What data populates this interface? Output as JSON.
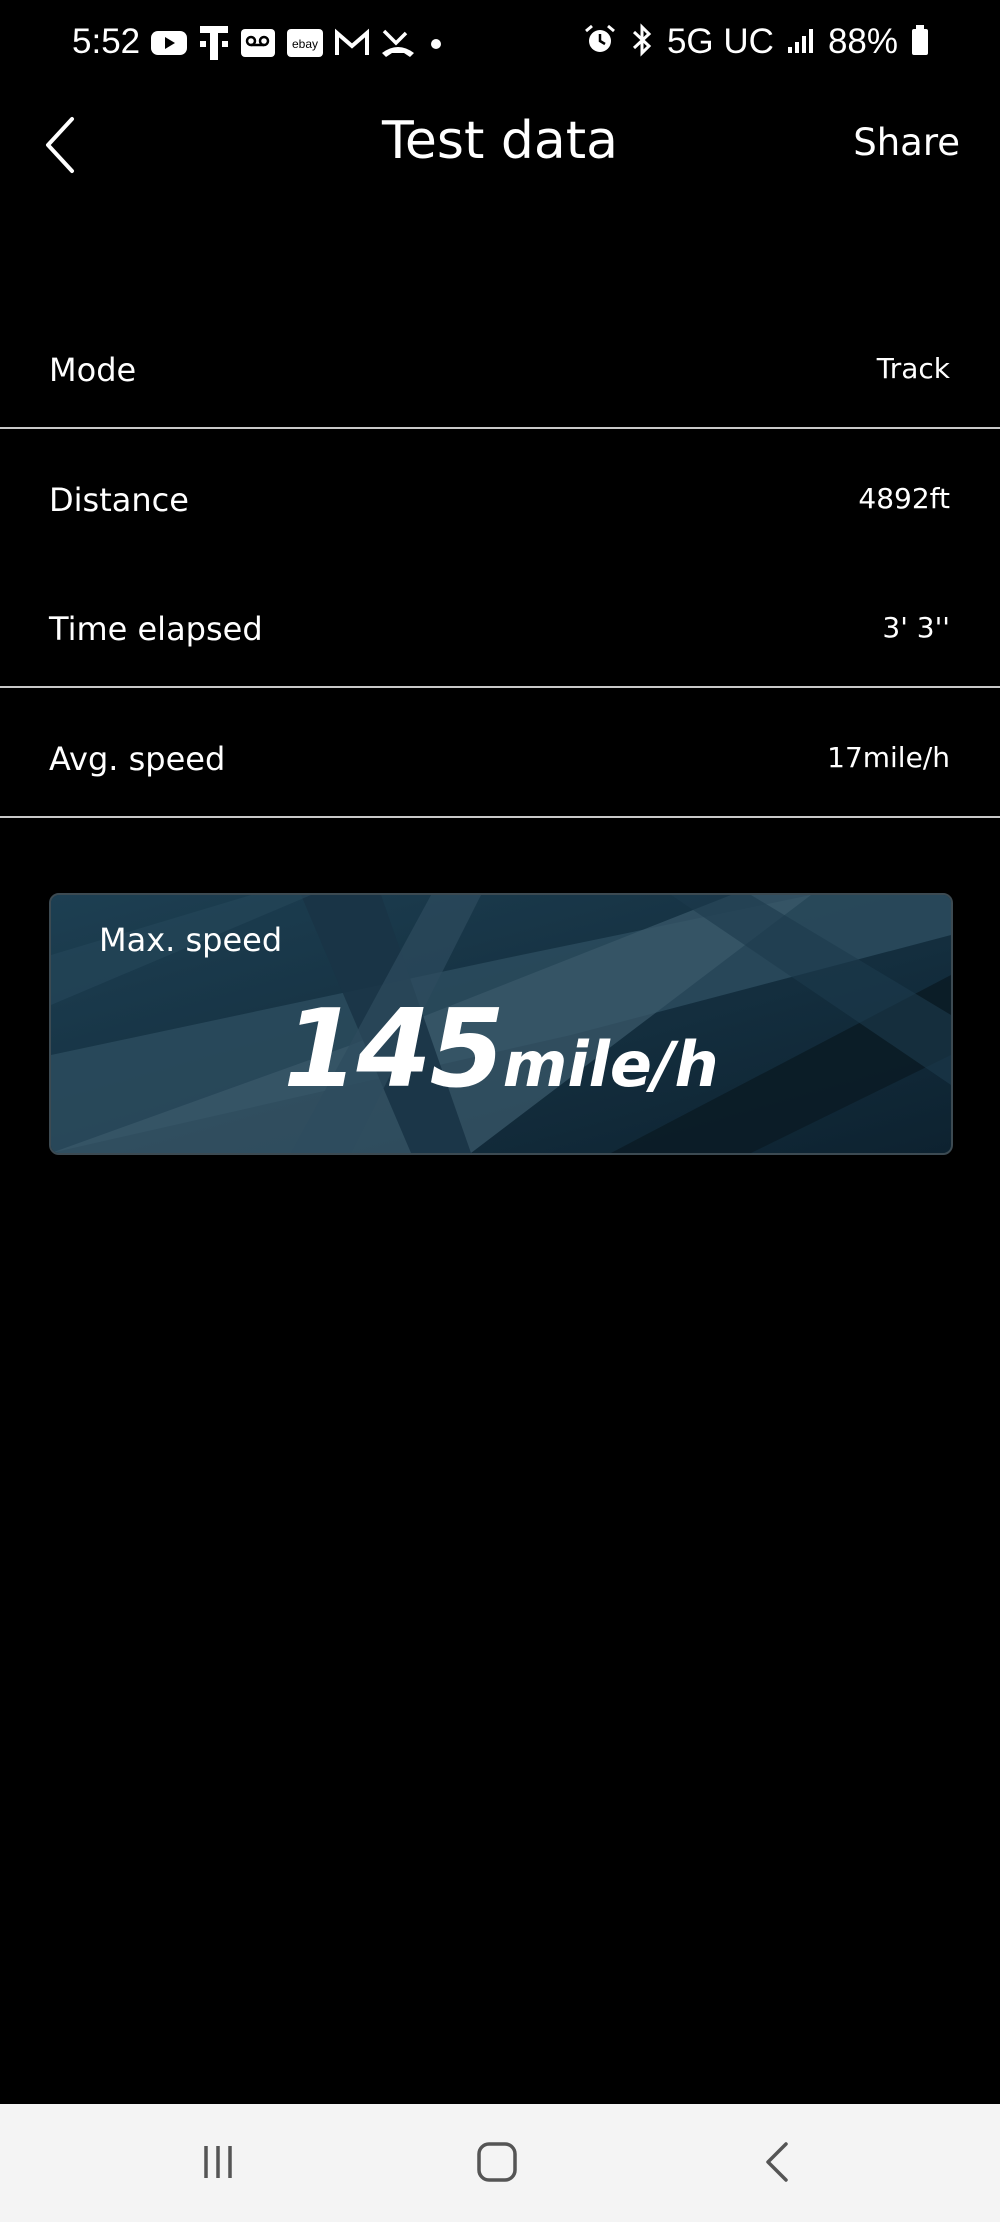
{
  "status_bar": {
    "time": "5:52",
    "network": "5G UC",
    "battery": "88%",
    "left_icons": [
      "youtube-icon",
      "t-mobile-icon",
      "voicemail-icon",
      "ebay-icon",
      "gmail-icon",
      "missed-call-icon",
      "dot-icon"
    ],
    "right_icons": [
      "alarm-icon",
      "bluetooth-icon",
      "signal-icon",
      "battery-icon"
    ]
  },
  "header": {
    "title": "Test data",
    "share_label": "Share",
    "back_icon": "chevron-left-icon"
  },
  "rows": [
    {
      "label": "Mode",
      "value": "Track"
    },
    {
      "label": "Distance",
      "value": "4892ft"
    },
    {
      "label": "Time elapsed",
      "value": "3' 3''"
    },
    {
      "label": "Avg. speed",
      "value": "17mile/h"
    }
  ],
  "max_speed": {
    "label": "Max. speed",
    "value": "145",
    "unit": "mile/h"
  },
  "nav_bar": {
    "icons": [
      "recent-apps-icon",
      "home-icon",
      "back-icon"
    ]
  },
  "colors": {
    "background": "#000000",
    "card_base": "#163241",
    "divider": "#c8c8c8",
    "nav_bar": "#f4f4f4"
  }
}
